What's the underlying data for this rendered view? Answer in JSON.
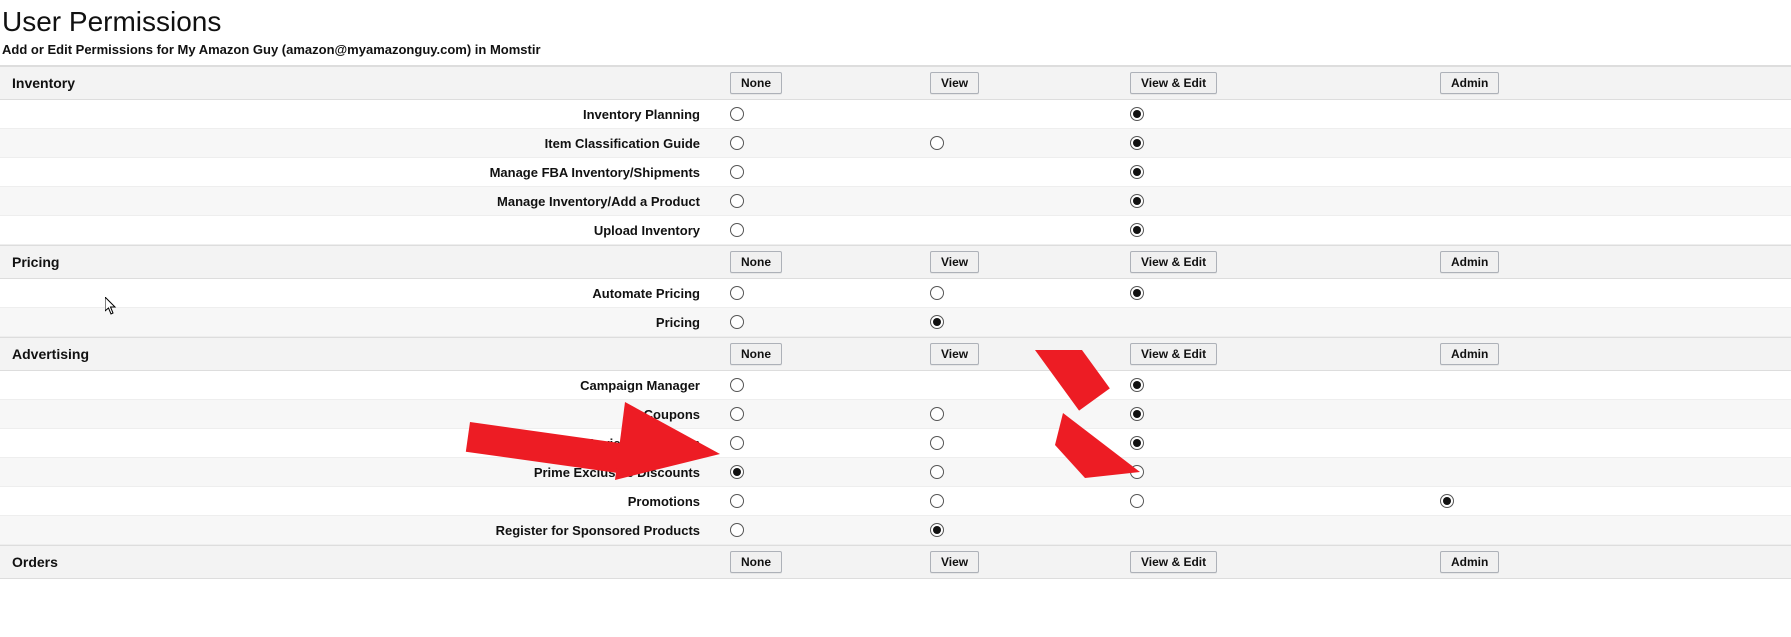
{
  "page": {
    "title": "User Permissions",
    "subtitle": "Add or Edit Permissions for My Amazon Guy (amazon@myamazonguy.com) in Momstir"
  },
  "headers": {
    "none": "None",
    "view": "View",
    "view_edit": "View & Edit",
    "admin": "Admin"
  },
  "sections": [
    {
      "name": "Inventory",
      "rows": [
        {
          "label": "Inventory Planning",
          "cells": [
            "empty",
            "absent",
            "selected",
            "absent"
          ]
        },
        {
          "label": "Item Classification Guide",
          "cells": [
            "empty",
            "empty",
            "selected",
            "absent"
          ]
        },
        {
          "label": "Manage FBA Inventory/Shipments",
          "cells": [
            "empty",
            "absent",
            "selected",
            "absent"
          ]
        },
        {
          "label": "Manage Inventory/Add a Product",
          "cells": [
            "empty",
            "absent",
            "selected",
            "absent"
          ]
        },
        {
          "label": "Upload Inventory",
          "cells": [
            "empty",
            "absent",
            "selected",
            "absent"
          ]
        }
      ]
    },
    {
      "name": "Pricing",
      "rows": [
        {
          "label": "Automate Pricing",
          "cells": [
            "empty",
            "empty",
            "selected",
            "absent"
          ]
        },
        {
          "label": "Pricing",
          "cells": [
            "empty",
            "selected",
            "absent",
            "absent"
          ]
        }
      ]
    },
    {
      "name": "Advertising",
      "rows": [
        {
          "label": "Campaign Manager",
          "cells": [
            "empty",
            "absent",
            "selected",
            "absent"
          ]
        },
        {
          "label": "Coupons",
          "cells": [
            "empty",
            "empty",
            "selected",
            "absent"
          ]
        },
        {
          "label": "Early Reviewer Program",
          "cells": [
            "empty",
            "empty",
            "selected",
            "absent"
          ]
        },
        {
          "label": "Prime Exclusive Discounts",
          "cells": [
            "selected",
            "empty",
            "empty",
            "absent"
          ]
        },
        {
          "label": "Promotions",
          "cells": [
            "empty",
            "empty",
            "empty",
            "selected"
          ]
        },
        {
          "label": "Register for Sponsored Products",
          "cells": [
            "empty",
            "selected",
            "absent",
            "absent"
          ]
        }
      ]
    },
    {
      "name": "Orders",
      "rows": []
    }
  ]
}
